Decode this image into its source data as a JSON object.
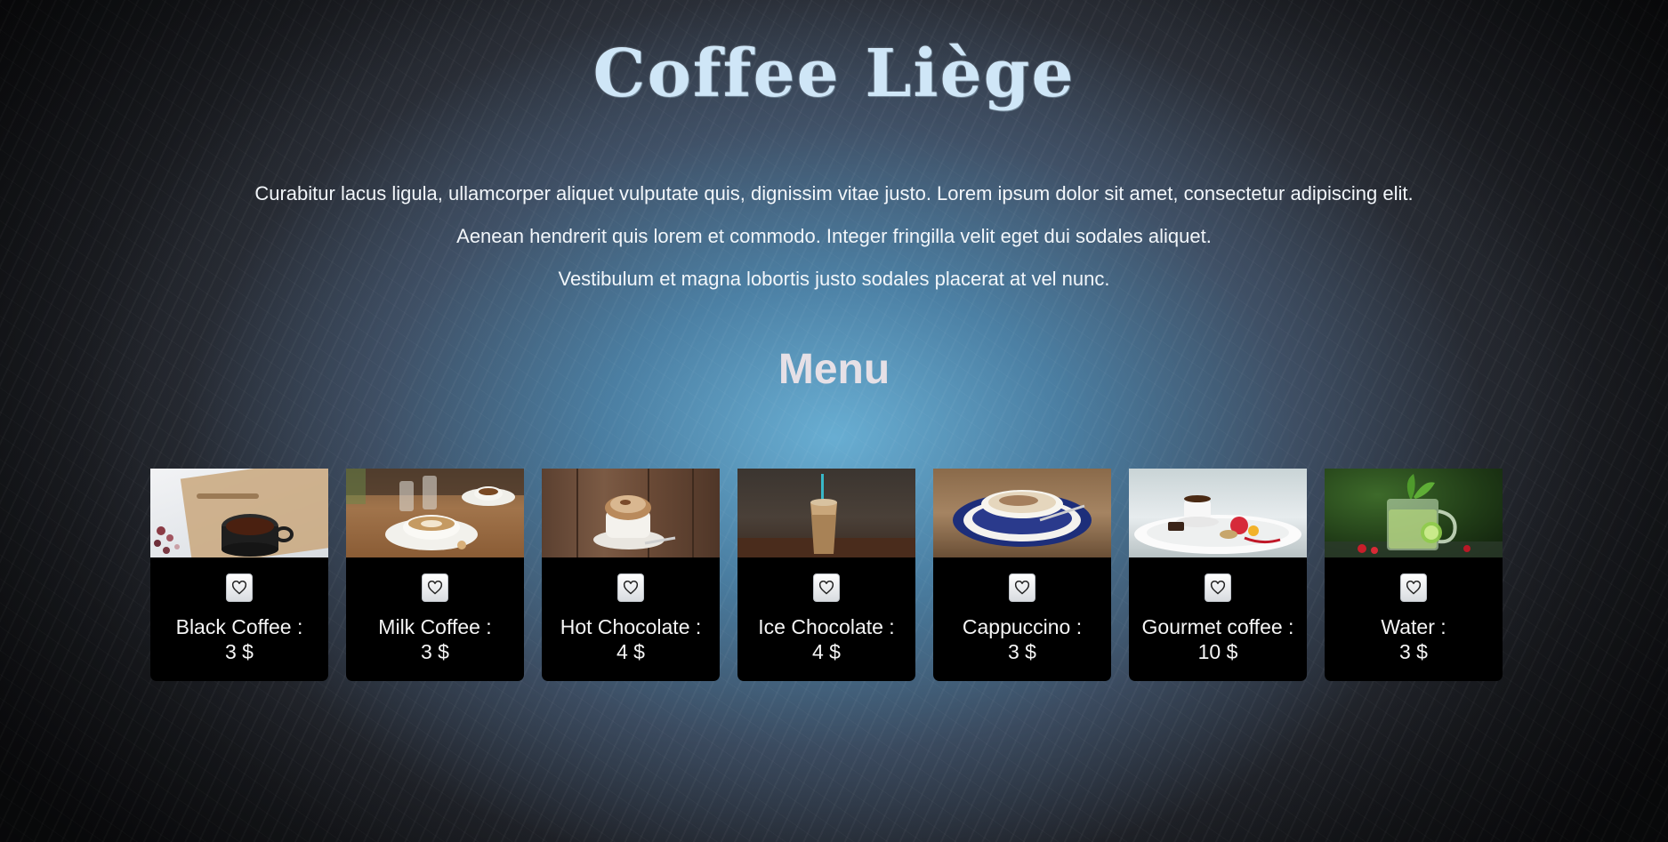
{
  "site": {
    "title": "Coffee Liège"
  },
  "intro": {
    "lines": [
      "Curabitur lacus ligula, ullamcorper aliquet vulputate quis, dignissim vitae justo. Lorem ipsum dolor sit amet, consectetur adipiscing elit.",
      "Aenean hendrerit quis lorem et commodo. Integer fringilla velit eget dui sodales aliquet.",
      "Vestibulum et magna lobortis justo sodales placerat at vel nunc."
    ]
  },
  "menu": {
    "title": "Menu",
    "favorite_icon": "heart-icon",
    "items": [
      {
        "name": "Black Coffee :",
        "price": "3 $",
        "photo": "black-coffee-photo"
      },
      {
        "name": "Milk Coffee :",
        "price": "3 $",
        "photo": "milk-coffee-photo"
      },
      {
        "name": "Hot Chocolate :",
        "price": "4 $",
        "photo": "hot-chocolate-photo"
      },
      {
        "name": "Ice Chocolate :",
        "price": "4 $",
        "photo": "ice-chocolate-photo"
      },
      {
        "name": "Cappuccino :",
        "price": "3 $",
        "photo": "cappuccino-photo"
      },
      {
        "name": "Gourmet coffee :",
        "price": "10 $",
        "photo": "gourmet-coffee-photo"
      },
      {
        "name": "Water :",
        "price": "3 $",
        "photo": "water-photo"
      }
    ]
  },
  "colors": {
    "title": "#cfe6f7",
    "card_background": "#000000",
    "text": "#ffffff"
  }
}
